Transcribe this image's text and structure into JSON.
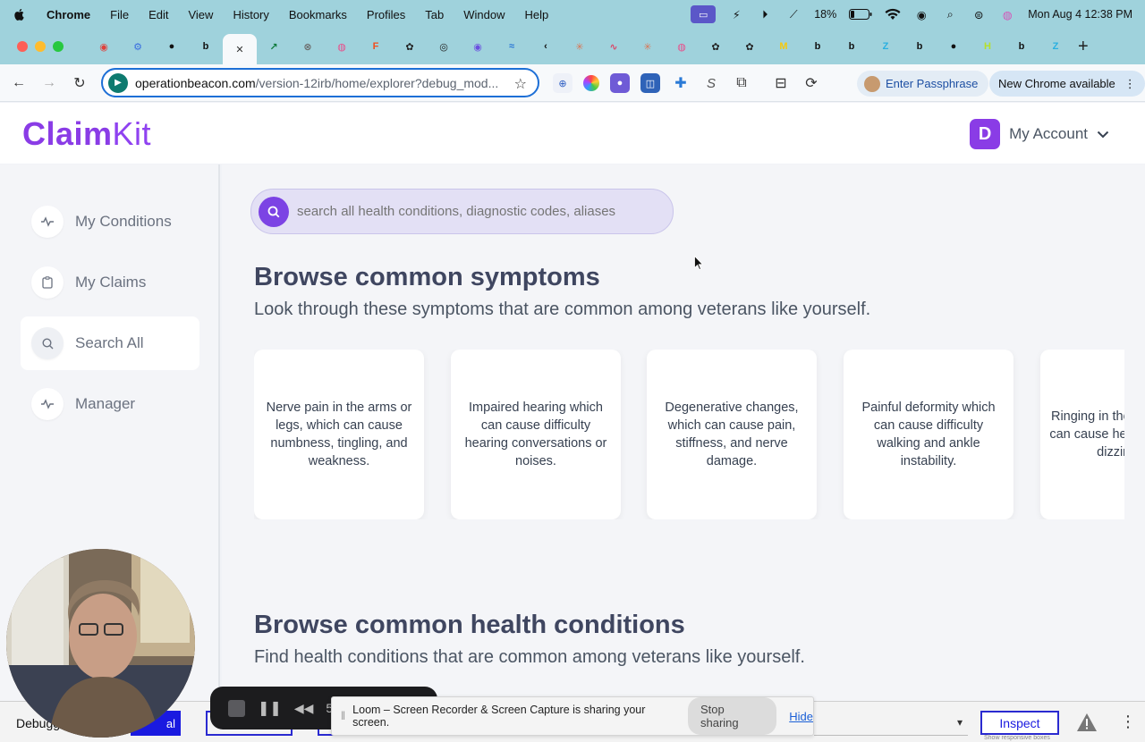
{
  "menubar": {
    "app_name": "Chrome",
    "items": [
      "File",
      "Edit",
      "View",
      "History",
      "Bookmarks",
      "Profiles",
      "Tab",
      "Window",
      "Help"
    ],
    "battery": "18%",
    "datetime": "Mon Aug 4  12:38 PM"
  },
  "tabs": [
    {
      "icon": "record-icon",
      "glyph": "◉",
      "color": "#e0413b"
    },
    {
      "icon": "gear-chip-icon",
      "glyph": "⚙",
      "color": "#3a6fe0"
    },
    {
      "icon": "github-icon",
      "glyph": "●",
      "color": "#111111"
    },
    {
      "icon": "beacon-icon",
      "glyph": "b",
      "color": "#111111"
    },
    {
      "icon": "close-icon",
      "glyph": "✕",
      "color": "#333333"
    },
    {
      "icon": "chart-icon",
      "glyph": "↗",
      "color": "#0e7a3c"
    },
    {
      "icon": "api-icon",
      "glyph": "⊗",
      "color": "#6b6b6b"
    },
    {
      "icon": "dribbble-icon",
      "glyph": "◍",
      "color": "#ea4c89"
    },
    {
      "icon": "figma-icon",
      "glyph": "F",
      "color": "#f24e1e"
    },
    {
      "icon": "openai-icon",
      "glyph": "✿",
      "color": "#222222"
    },
    {
      "icon": "compass-icon",
      "glyph": "◎",
      "color": "#222222"
    },
    {
      "icon": "target-icon",
      "glyph": "◉",
      "color": "#6b4fe0"
    },
    {
      "icon": "wave-icon",
      "glyph": "≈",
      "color": "#2a77d6"
    },
    {
      "icon": "back-chevron-icon",
      "glyph": "‹",
      "color": "#111111"
    },
    {
      "icon": "claude-icon",
      "glyph": "✳",
      "color": "#d97757"
    },
    {
      "icon": "squiggle-icon",
      "glyph": "∿",
      "color": "#d94a6a"
    },
    {
      "icon": "claude-icon",
      "glyph": "✳",
      "color": "#d97757"
    },
    {
      "icon": "dribbble-icon",
      "glyph": "◍",
      "color": "#ea4c89"
    },
    {
      "icon": "openai-icon",
      "glyph": "✿",
      "color": "#222222"
    },
    {
      "icon": "openai-icon",
      "glyph": "✿",
      "color": "#222222"
    },
    {
      "icon": "miro-icon",
      "glyph": "M",
      "color": "#f6c90e"
    },
    {
      "icon": "beacon-icon",
      "glyph": "b",
      "color": "#111111"
    },
    {
      "icon": "beacon-icon",
      "glyph": "b",
      "color": "#111111"
    },
    {
      "icon": "z-icon",
      "glyph": "Z",
      "color": "#2ab0e0"
    },
    {
      "icon": "beacon-icon",
      "glyph": "b",
      "color": "#111111"
    },
    {
      "icon": "dot-icon",
      "glyph": "●",
      "color": "#111111"
    },
    {
      "icon": "h-icon",
      "glyph": "H",
      "color": "#b6e02a"
    },
    {
      "icon": "beacon-icon",
      "glyph": "b",
      "color": "#111111"
    },
    {
      "icon": "z-icon",
      "glyph": "Z",
      "color": "#2ab0e0"
    }
  ],
  "address": {
    "host": "operationbeacon.com",
    "path": "/version-12irb/home/explorer?debug_mod..."
  },
  "toolbar": {
    "passphrase_label": "Enter Passphrase",
    "new_chrome_label": "New Chrome available"
  },
  "app": {
    "logo_bold": "Claim",
    "logo_light": "Kit",
    "account_initial": "D",
    "account_label": "My Account"
  },
  "sidebar": {
    "items": [
      {
        "label": "My Conditions",
        "icon": "pulse-icon"
      },
      {
        "label": "My Claims",
        "icon": "clipboard-icon"
      },
      {
        "label": "Search All",
        "icon": "search-icon"
      },
      {
        "label": "Manager",
        "icon": "pulse-icon"
      }
    ],
    "active_index": 2
  },
  "search": {
    "placeholder": "search all health conditions, diagnostic codes, aliases"
  },
  "symptoms": {
    "title": "Browse common symptoms",
    "subtitle": "Look through these symptoms that are common among veterans like yourself.",
    "cards": [
      "Nerve pain in the arms or legs, which can cause numbness, tingling, and weakness.",
      "Impaired hearing which can cause difficulty hearing conversations or noises.",
      "Degenerative changes, which can cause pain, stiffness, and nerve damage.",
      "Painful deformity which can cause difficulty walking and ankle instability.",
      "Ringing in the ears, which can cause headaches and dizziness."
    ]
  },
  "conditions": {
    "title": "Browse common health conditions",
    "subtitle": "Find health conditions that are common among veterans like yourself."
  },
  "devbar": {
    "debug_label": "Debugg",
    "blue_button_label": "al",
    "inspect_label": "Inspect",
    "inspect_sub": "Show responsive boxes"
  },
  "loom": {
    "timer": "5",
    "message": "Loom – Screen Recorder & Screen Capture is sharing your screen.",
    "stop_label": "Stop sharing",
    "hide_label": "Hide"
  }
}
